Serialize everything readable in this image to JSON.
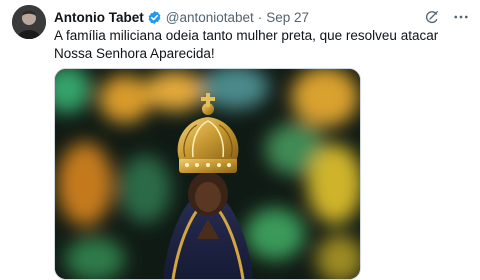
{
  "tweet": {
    "author_name": "Antonio Tabet",
    "handle": "@antoniotabet",
    "separator": "·",
    "date": "Sep 27",
    "text": "A família miliciana odeia tanto mulher preta, que resolveu atacar Nossa Senhora Aparecida!",
    "verified_color": "#1d9bf0",
    "media_icon": "statue-photo"
  },
  "icons": {
    "verified": "verified-badge-icon",
    "grok": "grok-icon",
    "more": "more-icon"
  }
}
